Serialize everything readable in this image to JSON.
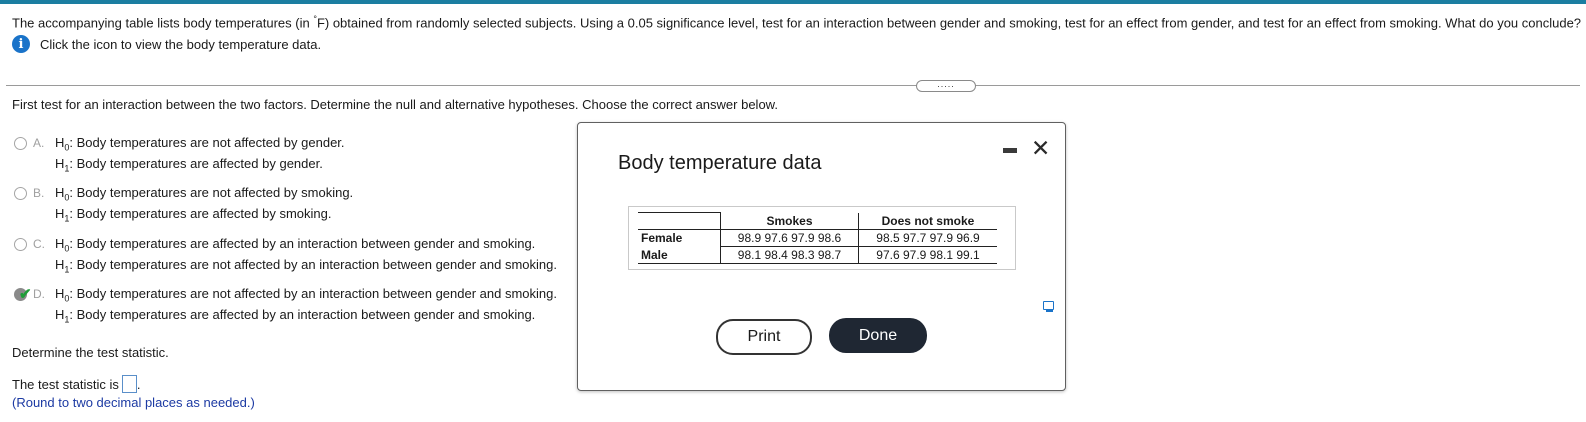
{
  "question": {
    "text_before": "The accompanying table lists body temperatures (in ",
    "degree": "°",
    "text_after": "F) obtained from randomly selected subjects. Using a 0.05 significance level, test for an interaction between gender and smoking, test for an effect from gender, and test for an effect from smoking. What do you conclude?",
    "info_text": "Click the icon to view the body temperature data.",
    "info_icon": "info-icon"
  },
  "more_handle": ".....",
  "instruction": "First test for an interaction between the two factors. Determine the null and alternative hypotheses. Choose the correct answer below.",
  "options": [
    {
      "letter": "A.",
      "h0": "Body temperatures are not affected by gender.",
      "h1": "Body temperatures are affected by gender."
    },
    {
      "letter": "B.",
      "h0": "Body temperatures are not affected by smoking.",
      "h1": "Body temperatures are affected by smoking."
    },
    {
      "letter": "C.",
      "h0": "Body temperatures are affected by an interaction between gender and smoking.",
      "h1": "Body temperatures are not affected by an interaction between gender and smoking."
    },
    {
      "letter": "D.",
      "h0": "Body temperatures are not affected by an interaction between gender and smoking.",
      "h1": "Body temperatures are affected by an interaction between gender and smoking."
    }
  ],
  "selected_option": "D.",
  "h0_label": "H",
  "h0_sub": "0",
  "h1_label": "H",
  "h1_sub": "1",
  "check_mark": "✔",
  "test_stat": {
    "prompt": "Determine the test statistic.",
    "label": "The test statistic is",
    "suffix": ".",
    "value": "",
    "hint": "(Round to two decimal places as needed.)"
  },
  "dialog": {
    "title": "Body temperature data",
    "close_glyph": "✕",
    "columns": [
      "",
      "Smokes",
      "Does not smoke"
    ],
    "rows": [
      {
        "label": "Female",
        "smokes": "98.9 97.6 97.9 98.6",
        "not_smoke": "98.5 97.7 97.9 96.9"
      },
      {
        "label": "Male",
        "smokes": "98.1 98.4 98.3 98.7",
        "not_smoke": "97.6 97.9 98.1 99.1"
      }
    ],
    "print_label": "Print",
    "done_label": "Done"
  },
  "colors": {
    "accent": "#1b7ea1",
    "info": "#1a73c9",
    "done_bg": "#1f2733",
    "check": "#1f9d38",
    "hint": "#1c3aa3"
  }
}
